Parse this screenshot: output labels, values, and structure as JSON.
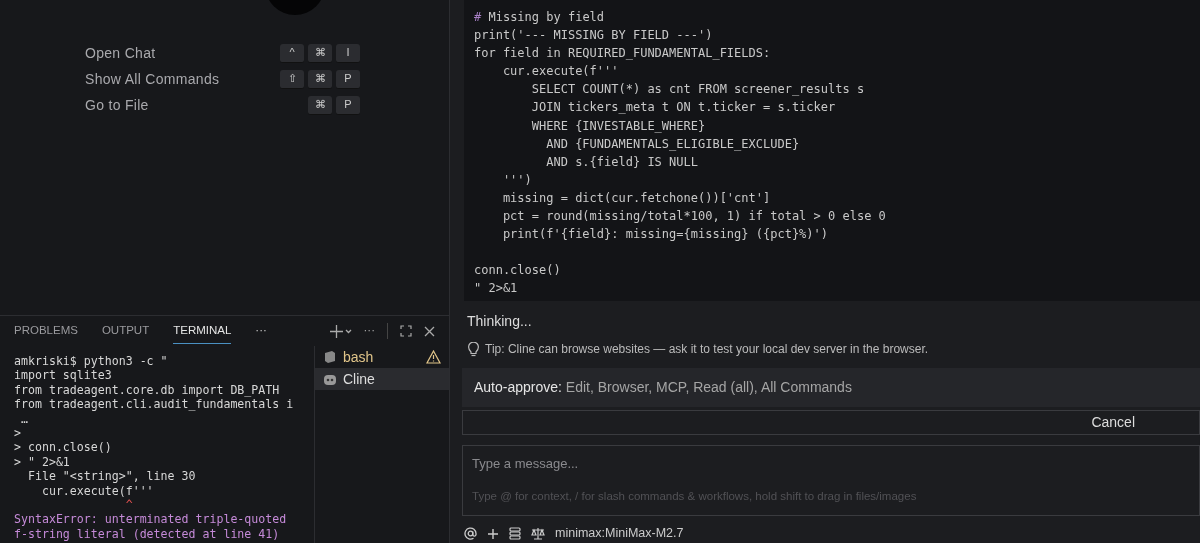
{
  "shortcuts": [
    {
      "label": "Open Chat",
      "keys": [
        "^",
        "⌘",
        "I"
      ]
    },
    {
      "label": "Show All Commands",
      "keys": [
        "⇧",
        "⌘",
        "P"
      ]
    },
    {
      "label": "Go to File",
      "keys": [
        "⌘",
        "P"
      ]
    }
  ],
  "panel": {
    "tabs": [
      {
        "label": "PROBLEMS",
        "selected": false
      },
      {
        "label": "OUTPUT",
        "selected": false
      },
      {
        "label": "TERMINAL",
        "selected": true
      }
    ],
    "more": "···",
    "actions_more": "···"
  },
  "terminal": {
    "lines": [
      {
        "kind": "plain",
        "text": "amkriski$ python3 -c \""
      },
      {
        "kind": "plain",
        "text": "import sqlite3"
      },
      {
        "kind": "plain",
        "text": "from tradeagent.core.db import DB_PATH"
      },
      {
        "kind": "plain",
        "text": "from tradeagent.cli.audit_fundamentals i"
      },
      {
        "kind": "plain",
        "text": " …"
      },
      {
        "kind": "plain",
        "text": ">"
      },
      {
        "kind": "plain",
        "text": "> conn.close()"
      },
      {
        "kind": "plain",
        "text": "> \" 2>&1"
      },
      {
        "kind": "plain",
        "text": "  File \"<string>\", line 30"
      },
      {
        "kind": "plain",
        "text": "    cur.execute(f'''"
      },
      {
        "kind": "caret",
        "text": "                ^"
      },
      {
        "kind": "error",
        "text": "SyntaxError: unterminated triple-quoted"
      },
      {
        "kind": "error",
        "text": "f-string literal (detected at line 41)"
      }
    ],
    "sessions": [
      {
        "name": "bash",
        "selected": false,
        "warning": true
      },
      {
        "name": "Cline",
        "selected": true,
        "warning": false
      }
    ]
  },
  "code": {
    "lines": [
      {
        "kind": "comment",
        "text": "# Missing by field"
      },
      {
        "kind": "plain",
        "text": "print('--- MISSING BY FIELD ---')"
      },
      {
        "kind": "plain",
        "text": "for field in REQUIRED_FUNDAMENTAL_FIELDS:"
      },
      {
        "kind": "plain",
        "text": "    cur.execute(f'''"
      },
      {
        "kind": "plain",
        "text": "        SELECT COUNT(*) as cnt FROM screener_results s"
      },
      {
        "kind": "plain",
        "text": "        JOIN tickers_meta t ON t.ticker = s.ticker"
      },
      {
        "kind": "plain",
        "text": "        WHERE {INVESTABLE_WHERE}"
      },
      {
        "kind": "plain",
        "text": "          AND {FUNDAMENTALS_ELIGIBLE_EXCLUDE}"
      },
      {
        "kind": "plain",
        "text": "          AND s.{field} IS NULL"
      },
      {
        "kind": "plain",
        "text": "    ''')"
      },
      {
        "kind": "plain",
        "text": "    missing = dict(cur.fetchone())['cnt']"
      },
      {
        "kind": "plain",
        "text": "    pct = round(missing/total*100, 1) if total > 0 else 0"
      },
      {
        "kind": "plain",
        "text": "    print(f'{field}: missing={missing} ({pct}%)')"
      },
      {
        "kind": "blank"
      },
      {
        "kind": "plain",
        "text": "conn.close()"
      },
      {
        "kind": "plain",
        "text": "\" 2>&1"
      }
    ]
  },
  "chat": {
    "status": "Thinking...",
    "tip": "Tip: Cline can browse websites — ask it to test your local dev server in the browser.",
    "auto_approve": {
      "label": "Auto-approve:",
      "value": "Edit, Browser, MCP, Read (all), All Commands"
    },
    "cancel": "Cancel",
    "input": {
      "placeholder": "Type a message...",
      "hint": "Type @ for context, / for slash commands & workflows, hold shift to drag in files/images"
    },
    "model": "minimax:MiniMax-M2.7"
  }
}
